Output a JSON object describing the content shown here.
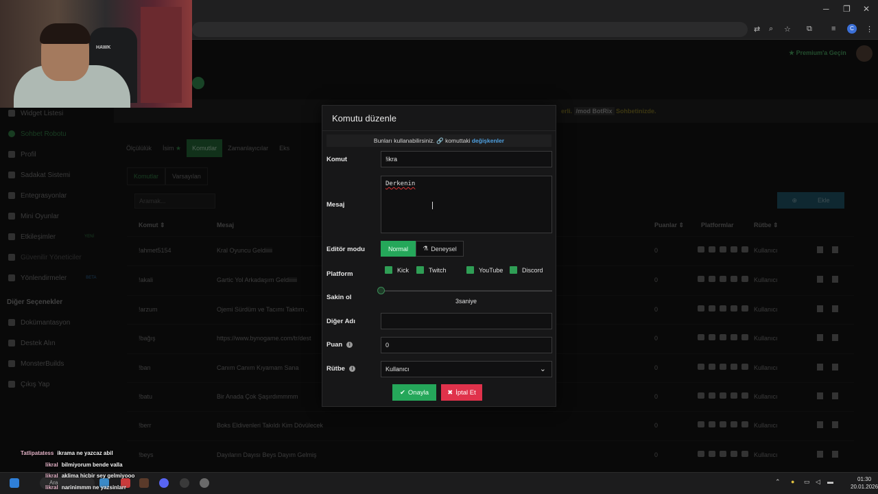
{
  "browser": {
    "premium_label": "Premium'a Geçin",
    "profile_initial": "C"
  },
  "webcam": {
    "label": "HAWK"
  },
  "sidebar": {
    "items": [
      {
        "label": "Widget Listesi",
        "icon": "widget-icon"
      },
      {
        "label": "Sohbet Robotu",
        "icon": "robot-icon",
        "active": true
      },
      {
        "label": "Profil",
        "icon": "profile-icon"
      },
      {
        "label": "Sadakat Sistemi",
        "icon": "trophy-icon"
      },
      {
        "label": "Entegrasyonlar",
        "icon": "integration-icon"
      },
      {
        "label": "Mini Oyunlar",
        "icon": "gamepad-icon"
      },
      {
        "label": "Etkileşimler",
        "icon": "music-icon",
        "badge": "YENİ"
      },
      {
        "label": "Güvenilir Yöneticiler",
        "icon": "shield-icon"
      },
      {
        "label": "Yönlendirmeler",
        "icon": "users-icon",
        "badge": "BETA"
      }
    ],
    "other_header": "Diğer Seçenekler",
    "other_items": [
      {
        "label": "Dokümantasyon",
        "icon": "doc-icon"
      },
      {
        "label": "Destek Alın",
        "icon": "help-icon"
      },
      {
        "label": "MonsterBuilds",
        "icon": "monitor-icon"
      },
      {
        "label": "Çıkış Yap",
        "icon": "logout-icon"
      }
    ]
  },
  "notice": {
    "text": "erli.",
    "command": "/mod BotRix",
    "suffix": "Sohbetinizde."
  },
  "tabs": [
    "Ölçülülük",
    "İsim",
    "Komutlar",
    "Zamanlayıcılar",
    "Eks"
  ],
  "subtabs": [
    "Komutlar",
    "Varsayılan"
  ],
  "search_placeholder": "Aramak...",
  "add_button": "Ekle",
  "table": {
    "headers": {
      "command": "Komut",
      "message": "Mesaj",
      "points": "Puanlar",
      "platforms": "Platformlar",
      "rank": "Rütbe"
    },
    "rows": [
      {
        "command": "!ahmet5154",
        "message": "Kral Oyuncu Geldiiiii",
        "points": "0",
        "rank": "Kullanıcı"
      },
      {
        "command": "!akali",
        "message": "Gartic Yol Arkadaşım Geldiiiiii",
        "points": "0",
        "rank": "Kullanıcı"
      },
      {
        "command": "!arzum",
        "message": "Ojemi Sürdüm ve Tacımı Taktım .",
        "points": "0",
        "rank": "Kullanıcı"
      },
      {
        "command": "!bağış",
        "message": "https://www.bynogame.com/tr/dest",
        "points": "0",
        "rank": "Kullanıcı"
      },
      {
        "command": "!ban",
        "message": "Canım Canım Kıyamam Sana",
        "points": "0",
        "rank": "Kullanıcı"
      },
      {
        "command": "!batu",
        "message": "Bir Anada Çok Şaşırdımmmm",
        "points": "0",
        "rank": "Kullanıcı"
      },
      {
        "command": "!berr",
        "message": "Boks Eldivenleri Takıldı Kim Dövülecek",
        "points": "0",
        "rank": "Kullanıcı"
      },
      {
        "command": "!beys",
        "message": "Dayıların Dayısı Beys Dayım Gelmiş",
        "points": "0",
        "rank": "Kullanıcı"
      }
    ]
  },
  "modal": {
    "title": "Komutu düzenle",
    "info_prefix": "Bunları kullanabilirsiniz.",
    "info_mid": "komuttaki",
    "info_link": "değişkenler",
    "command_label": "Komut",
    "command_value": "!ikra",
    "message_label": "Mesaj",
    "message_value": "Derkenin",
    "editor_label": "Editör modu",
    "mode_normal": "Normal",
    "mode_experimental": "Deneysel",
    "platform_label": "Platform",
    "platforms": [
      "Kick",
      "Twitch",
      "YouTube",
      "Discord"
    ],
    "cooldown_label": "Sakin ol",
    "cooldown_value": "3saniye",
    "cooldown_level": 0,
    "alias_label": "Diğer Adı",
    "alias_value": "",
    "points_label": "Puan",
    "points_value": "0",
    "rank_label": "Rütbe",
    "rank_value": "Kullanıcı",
    "confirm": "Onayla",
    "cancel": "İptal Et"
  },
  "chat": [
    {
      "user": "Tatlipatatess",
      "text": "ikrama ne yazcaz abil"
    },
    {
      "user": "likral",
      "text": "bilmiyorum bende valla"
    },
    {
      "user": "likral",
      "text": "aklima hicbir sey gelmiyooo"
    },
    {
      "user": "likral",
      "text": "narinimmm ne yazsinlarr"
    }
  ],
  "taskbar": {
    "search": "Ara",
    "time": "01:30",
    "date": "20.01.2026"
  }
}
